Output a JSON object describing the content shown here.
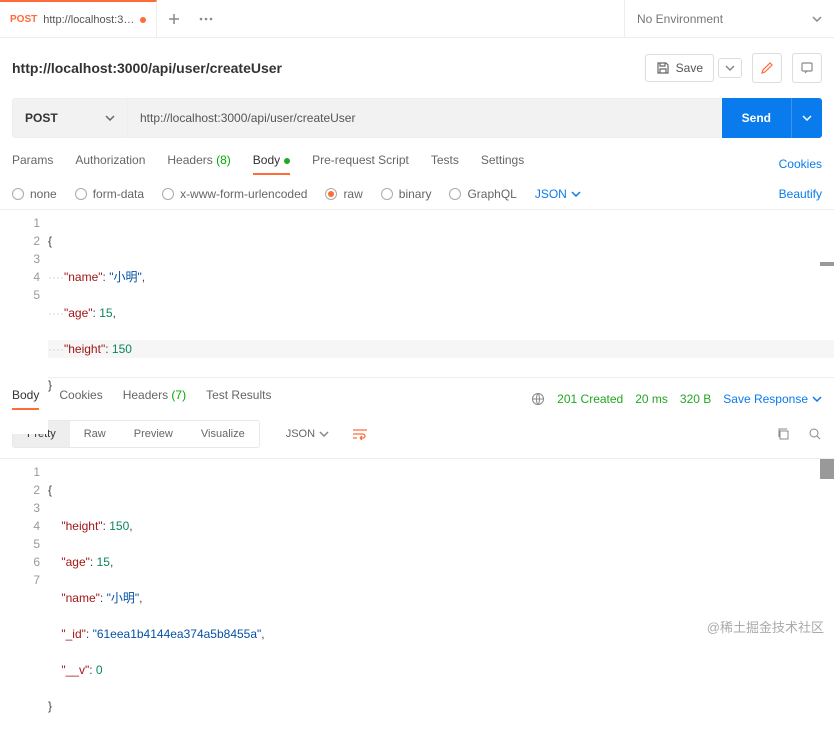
{
  "tab": {
    "method": "POST",
    "title": "http://localhost:3…"
  },
  "env": {
    "label": "No Environment"
  },
  "request": {
    "title": "http://localhost:3000/api/user/createUser",
    "method": "POST",
    "url": "http://localhost:3000/api/user/createUser",
    "save_label": "Save",
    "send_label": "Send"
  },
  "req_tabs": {
    "params": "Params",
    "auth": "Authorization",
    "headers": "Headers",
    "headers_count": "(8)",
    "body": "Body",
    "prerequest": "Pre-request Script",
    "tests": "Tests",
    "settings": "Settings",
    "cookies": "Cookies"
  },
  "body_types": {
    "none": "none",
    "formdata": "form-data",
    "xform": "x-www-form-urlencoded",
    "raw": "raw",
    "binary": "binary",
    "graphql": "GraphQL",
    "lang": "JSON",
    "beautify": "Beautify"
  },
  "req_body": {
    "l1_brace": "{",
    "l2_key": "\"name\"",
    "l2_val": "\"小明\"",
    "l3_key": "\"age\"",
    "l3_val": "15",
    "l4_key": "\"height\"",
    "l4_val": "150",
    "l5_brace": "}",
    "n1": "1",
    "n2": "2",
    "n3": "3",
    "n4": "4",
    "n5": "5"
  },
  "resp_tabs": {
    "body": "Body",
    "cookies": "Cookies",
    "headers": "Headers",
    "headers_count": "(7)",
    "tests": "Test Results"
  },
  "resp_meta": {
    "status": "201 Created",
    "time": "20 ms",
    "size": "320 B",
    "save": "Save Response"
  },
  "view": {
    "pretty": "Pretty",
    "raw": "Raw",
    "preview": "Preview",
    "visualize": "Visualize",
    "json": "JSON"
  },
  "resp_body": {
    "l1_brace": "{",
    "l2_key": "\"height\"",
    "l2_val": "150",
    "l3_key": "\"age\"",
    "l3_val": "15",
    "l4_key": "\"name\"",
    "l4_val": "\"小明\"",
    "l5_key": "\"_id\"",
    "l5_val": "\"61eea1b4144ea374a5b8455a\"",
    "l6_key": "\"__v\"",
    "l6_val": "0",
    "l7_brace": "}",
    "n1": "1",
    "n2": "2",
    "n3": "3",
    "n4": "4",
    "n5": "5",
    "n6": "6",
    "n7": "7"
  },
  "watermark": "@稀土掘金技术社区"
}
